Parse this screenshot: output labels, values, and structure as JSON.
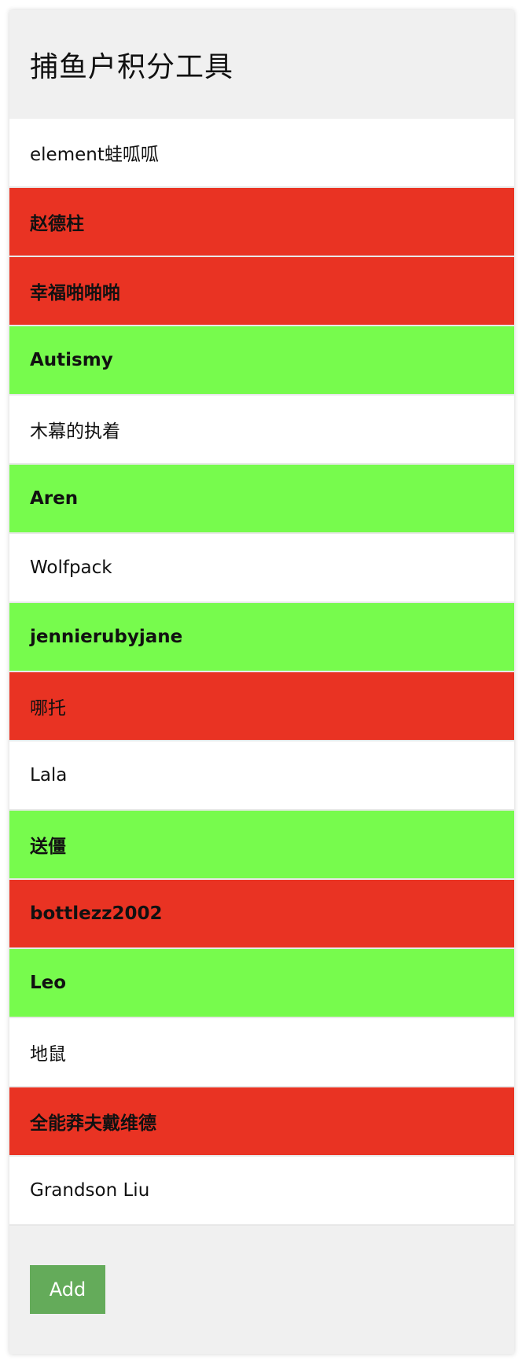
{
  "app": {
    "title": "捕鱼户积分工具"
  },
  "list": {
    "items": [
      {
        "name": "element蛙呱呱",
        "status": "plain",
        "bold": false
      },
      {
        "name": "赵德柱",
        "status": "red",
        "bold": true
      },
      {
        "name": "幸福啪啪啪",
        "status": "red",
        "bold": true
      },
      {
        "name": "Autismy",
        "status": "green",
        "bold": true
      },
      {
        "name": "木幕的执着",
        "status": "plain",
        "bold": false
      },
      {
        "name": "Aren",
        "status": "green",
        "bold": true
      },
      {
        "name": "Wolfpack",
        "status": "plain",
        "bold": false
      },
      {
        "name": "jennierubyjane",
        "status": "green",
        "bold": true
      },
      {
        "name": "哪托",
        "status": "red",
        "bold": false
      },
      {
        "name": "Lala",
        "status": "plain",
        "bold": false
      },
      {
        "name": "送僵",
        "status": "green",
        "bold": true
      },
      {
        "name": "bottlezz2002",
        "status": "red",
        "bold": true
      },
      {
        "name": "Leo",
        "status": "green",
        "bold": true
      },
      {
        "name": "地鼠",
        "status": "plain",
        "bold": false
      },
      {
        "name": "全能莽夫戴维德",
        "status": "red",
        "bold": true
      },
      {
        "name": "Grandson Liu",
        "status": "plain",
        "bold": false
      }
    ]
  },
  "footer": {
    "add_label": "Add"
  },
  "colors": {
    "red": "#e93323",
    "green": "#77fb4d",
    "plain": "#ffffff",
    "button": "#64ab5a",
    "panel": "#f0f0f0"
  }
}
